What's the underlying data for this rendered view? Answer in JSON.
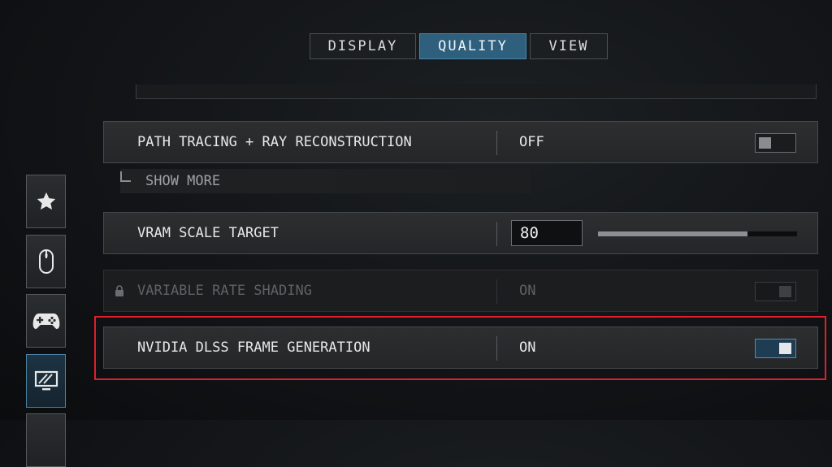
{
  "tabs": [
    {
      "label": "DISPLAY",
      "active": false
    },
    {
      "label": "QUALITY",
      "active": true
    },
    {
      "label": "VIEW",
      "active": false
    }
  ],
  "rows": {
    "path_tracing": {
      "label": "PATH TRACING + RAY RECONSTRUCTION",
      "value": "OFF"
    },
    "show_more": {
      "label": "SHOW MORE"
    },
    "vram": {
      "label": "VRAM SCALE TARGET",
      "value": "80",
      "slider_percent": 75
    },
    "vrs": {
      "label": "VARIABLE RATE SHADING",
      "value": "ON",
      "locked": true
    },
    "dlss_fg": {
      "label": "NVIDIA DLSS FRAME GENERATION",
      "value": "ON"
    }
  },
  "sidebar": {
    "items": [
      {
        "icon": "star-icon",
        "active": false
      },
      {
        "icon": "mouse-icon",
        "active": false
      },
      {
        "icon": "gamepad-icon",
        "active": false
      },
      {
        "icon": "monitor-icon",
        "active": true
      }
    ]
  },
  "colors": {
    "accent": "#2e5f7d",
    "highlight": "#e0202a"
  }
}
